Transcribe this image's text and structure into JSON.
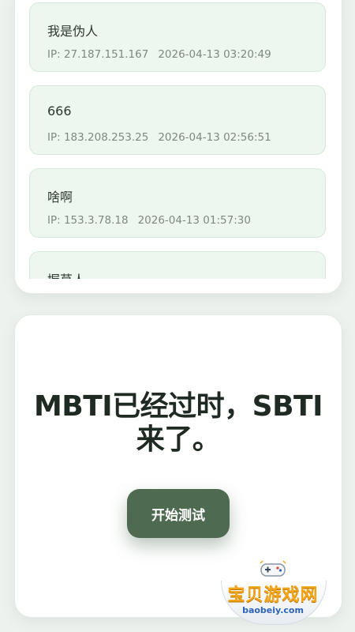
{
  "comments": [
    {
      "text": "我是伪人",
      "ip": "IP: 27.187.151.167",
      "time": "2026-04-13 03:20:49"
    },
    {
      "text": "666",
      "ip": "IP: 183.208.253.25",
      "time": "2026-04-13 02:56:51"
    },
    {
      "text": "啥啊",
      "ip": "IP: 153.3.78.18",
      "time": "2026-04-13 01:57:30"
    },
    {
      "text": "握草人",
      "ip": "",
      "time": ""
    }
  ],
  "hero": {
    "title_line1": "MBTI已经过时，SBTI",
    "title_line2": "来了。",
    "start_label": "开始测试"
  },
  "watermark": {
    "name": "宝贝游戏网",
    "url": "baobeiy.com",
    "icon": "gamepad-icon"
  },
  "colors": {
    "accent": "#4e6b52",
    "comment_bg": "#edf6ef",
    "page_bg": "#eef2ef"
  }
}
